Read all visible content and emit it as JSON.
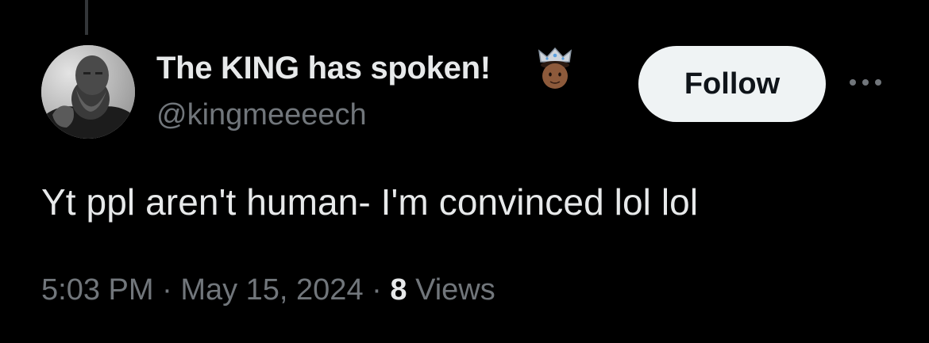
{
  "author": {
    "display_name": "The KING has spoken!",
    "handle": "@kingmeeeech",
    "name_emoji": "crowned-person-medium-dark-skin-emoji"
  },
  "actions": {
    "follow_label": "Follow",
    "more_icon": "more-horizontal-icon"
  },
  "tweet": {
    "text": "Yt ppl aren't human- I'm convinced lol lol"
  },
  "meta": {
    "time": "5:03 PM",
    "separator": "·",
    "date": "May 15, 2024",
    "views_count": "8",
    "views_label": "Views"
  },
  "colors": {
    "background": "#000000",
    "primary_text": "#e7e9ea",
    "secondary_text": "#71767b",
    "follow_button_bg": "#eff3f4",
    "follow_button_text": "#0f1419",
    "thread_line": "#333639"
  }
}
